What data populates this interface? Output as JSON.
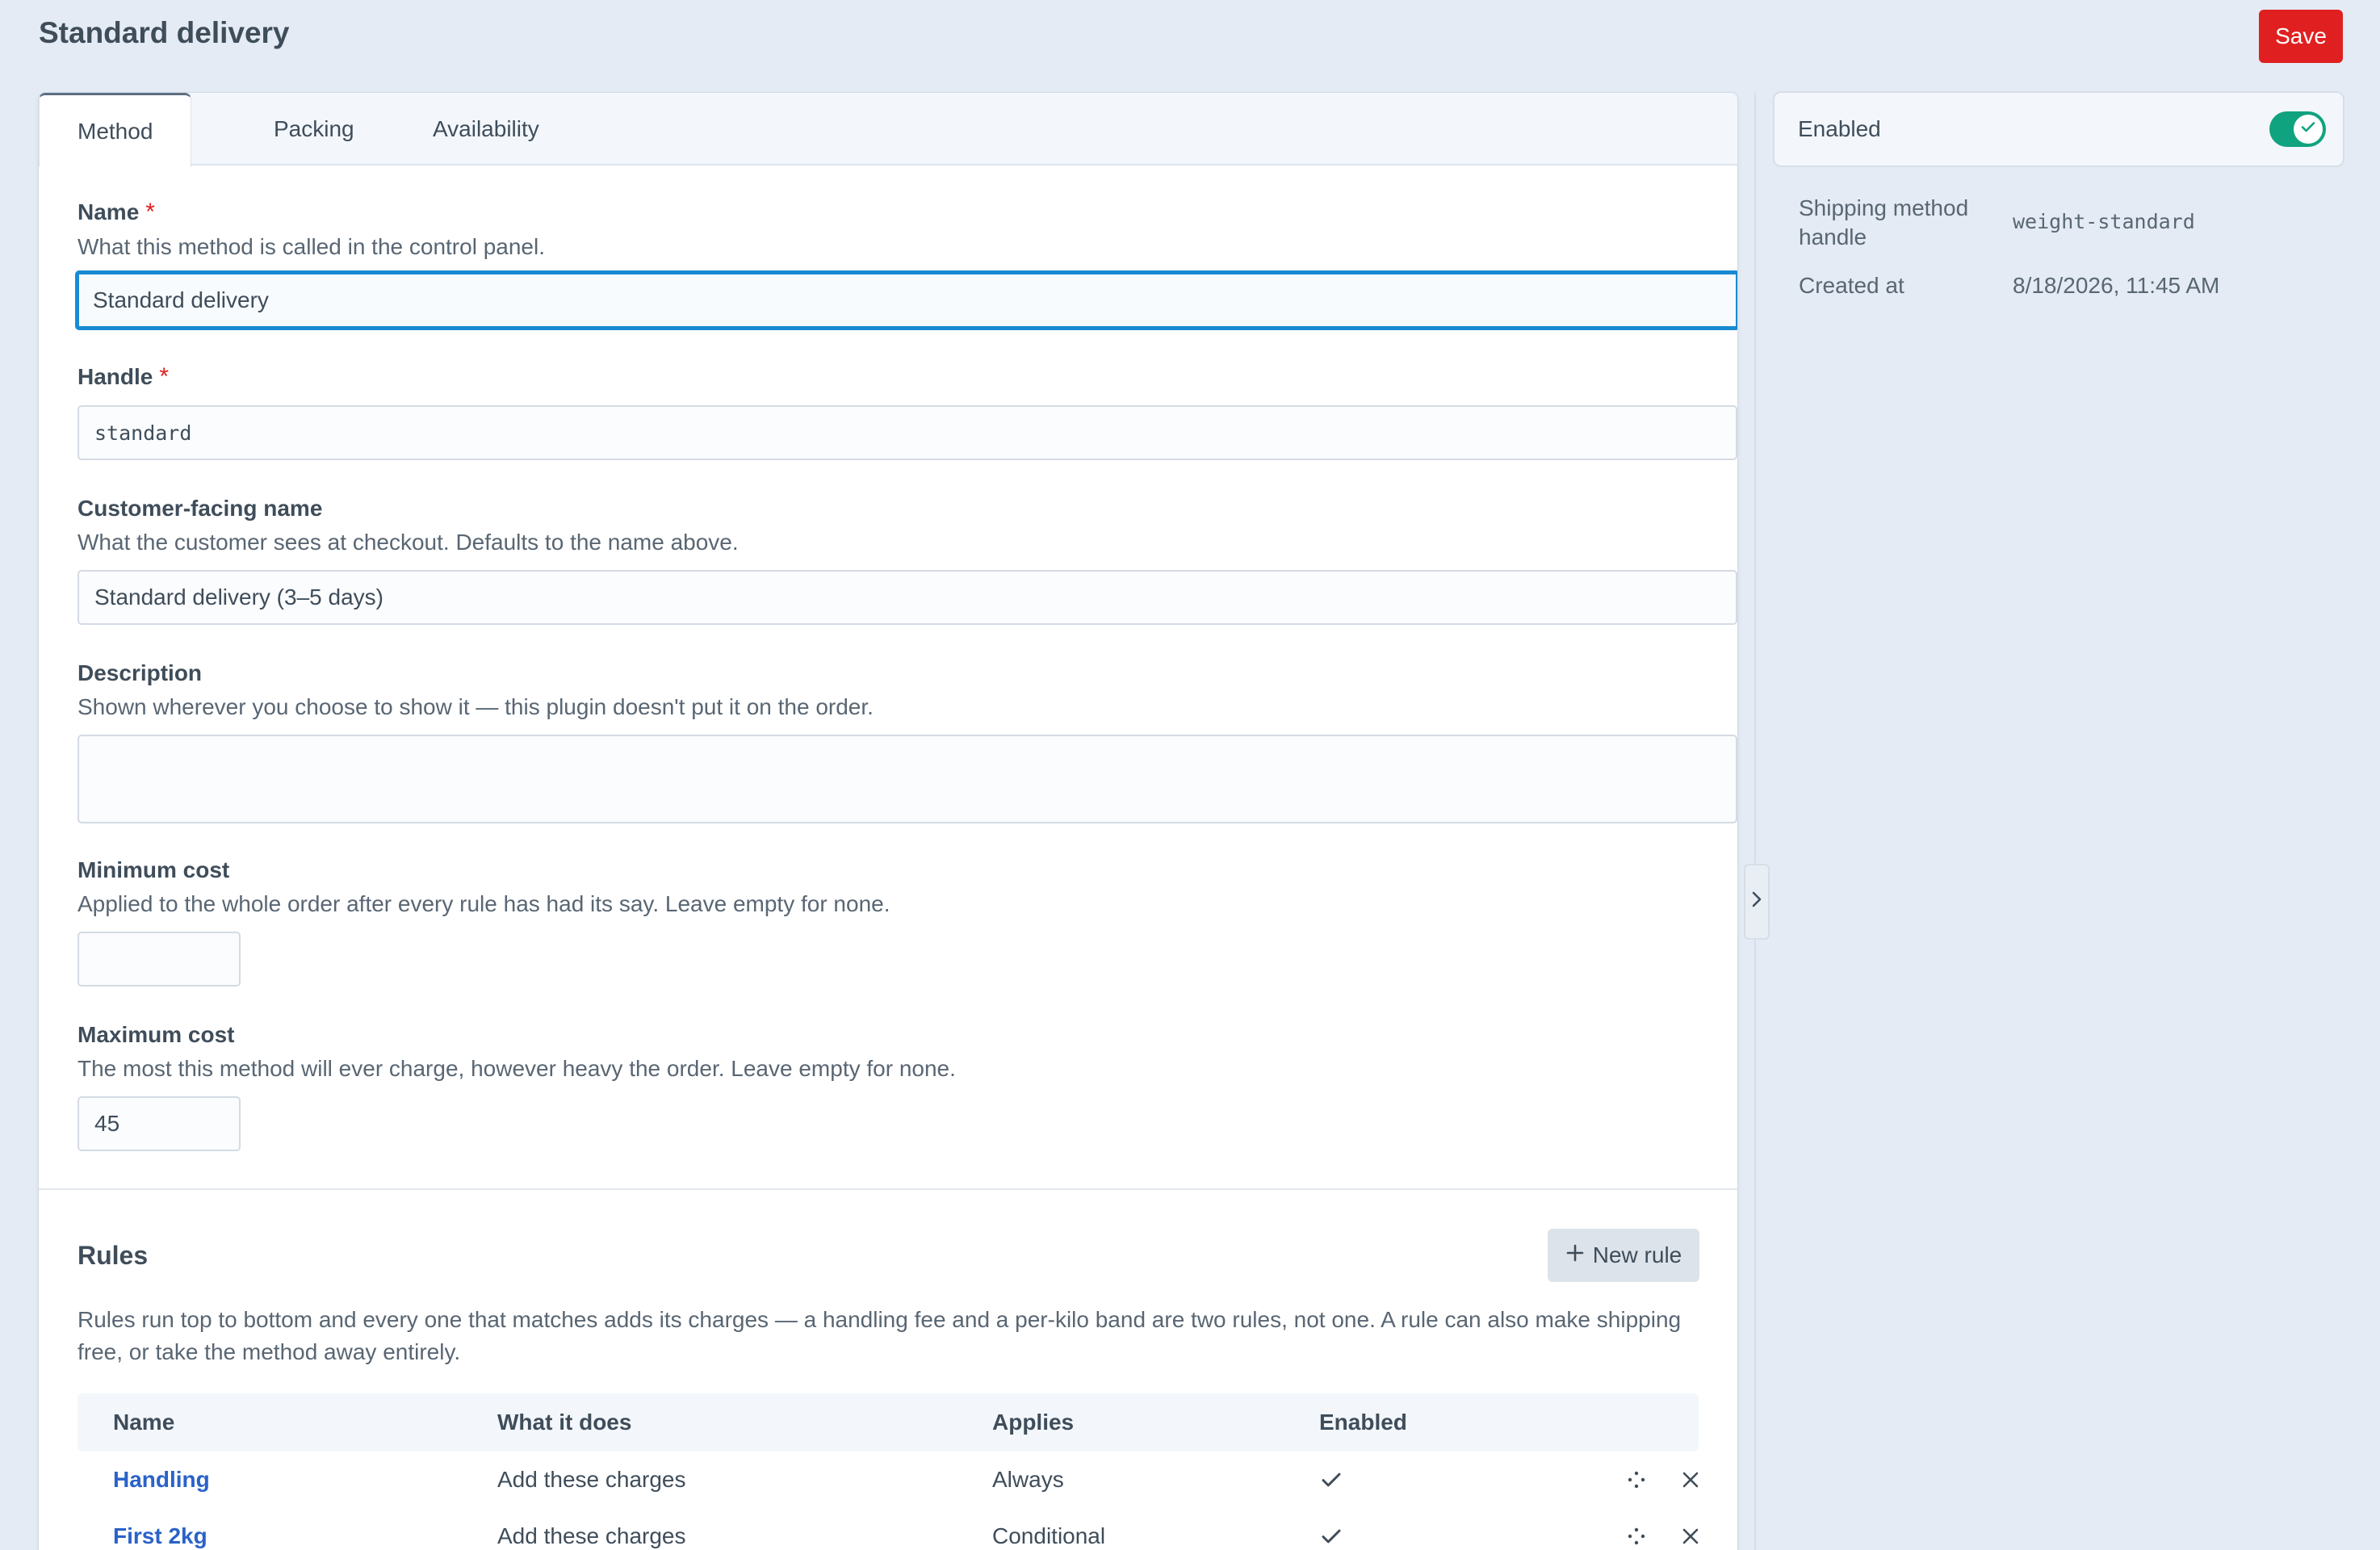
{
  "header": {
    "title": "Standard delivery",
    "save_label": "Save"
  },
  "tabs": [
    {
      "label": "Method",
      "active": true
    },
    {
      "label": "Packing",
      "active": false
    },
    {
      "label": "Availability",
      "active": false
    }
  ],
  "form": {
    "name": {
      "label": "Name",
      "required_mark": "*",
      "hint": "What this method is called in the control panel.",
      "value": "Standard delivery"
    },
    "handle": {
      "label": "Handle",
      "required_mark": "*",
      "value": "standard"
    },
    "customer_name": {
      "label": "Customer-facing name",
      "hint": "What the customer sees at checkout. Defaults to the name above.",
      "value": "Standard delivery (3–5 days)"
    },
    "description": {
      "label": "Description",
      "hint": "Shown wherever you choose to show it — this plugin doesn't put it on the order.",
      "value": ""
    },
    "min_cost": {
      "label": "Minimum cost",
      "hint": "Applied to the whole order after every rule has had its say. Leave empty for none.",
      "value": ""
    },
    "max_cost": {
      "label": "Maximum cost",
      "hint": "The most this method will ever charge, however heavy the order. Leave empty for none.",
      "value": "45"
    }
  },
  "rules": {
    "title": "Rules",
    "new_rule_label": "New rule",
    "description": "Rules run top to bottom and every one that matches adds its charges — a handling fee and a per-kilo band are two rules, not one. A rule can also make shipping free, or take the method away entirely.",
    "columns": [
      "Name",
      "What it does",
      "Applies",
      "Enabled"
    ],
    "rows": [
      {
        "name": "Handling",
        "does": "Add these charges",
        "applies": "Always",
        "enabled": true
      },
      {
        "name": "First 2kg",
        "does": "Add these charges",
        "applies": "Conditional",
        "enabled": true
      }
    ]
  },
  "sidebar": {
    "enabled_label": "Enabled",
    "enabled": true,
    "handle_label": "Shipping method handle",
    "handle_label_line1": "Shipping method",
    "handle_label_line2": "handle",
    "handle_value": "weight-standard",
    "created_label": "Created at",
    "created_value": "8/18/2026, 11:45 AM"
  },
  "colors": {
    "accent": "#1a8ad2",
    "danger": "#e02020",
    "toggle_on": "#10a37f",
    "link": "#2a62c9"
  }
}
